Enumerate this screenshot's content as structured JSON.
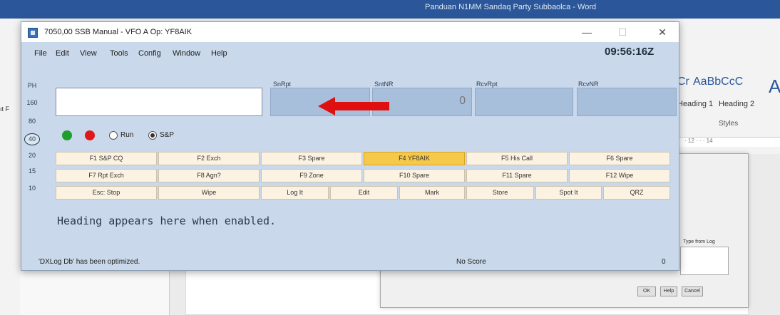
{
  "background": {
    "word_title": "Panduan N1MM Sandaq Party Subbaolca - Word",
    "style_normal": "AaBbCcC",
    "style_h1_label": "Heading 1",
    "style_h2_label": "Heading 2",
    "styles_group": "Styles",
    "ruler_text": "· 12 · · · 14",
    "heading_fragment": "Cr",
    "big_a": "A",
    "left_frag": "ıt F",
    "dialog_text": "Type from Log",
    "ok": "OK",
    "help": "Help",
    "cancel": "Cancel"
  },
  "window": {
    "title": "7050,00 SSB Manual - VFO A   Op: YF8AIK",
    "minimize": "—",
    "maximize": "☐",
    "close": "✕"
  },
  "menu": [
    "File",
    "Edit",
    "View",
    "Tools",
    "Config",
    "Window",
    "Help"
  ],
  "clock": "09:56:16Z",
  "bands": [
    "PH",
    "160",
    "80",
    "40",
    "20",
    "15",
    "10"
  ],
  "selected_band": "40",
  "fields": {
    "labels": [
      "SnRpt",
      "SntNR",
      "RcvRpt",
      "RcvNR"
    ],
    "sntnr_value": "0",
    "call_value": ""
  },
  "mode": {
    "run_label": "Run",
    "sp_label": "S&P",
    "selected": "S&P",
    "led_colors": [
      "#1f9e2c",
      "#e01818"
    ]
  },
  "fkeys": {
    "row1": [
      "F1 S&P CQ",
      "F2 Exch",
      "F3 Spare",
      "F4 YF8AIK",
      "F5 His Call",
      "F6 Spare"
    ],
    "row2": [
      "F7 Rpt Exch",
      "F8 Agn?",
      "F9 Zone",
      "F10 Spare",
      "F11 Spare",
      "F12 Wipe"
    ],
    "row3": [
      "Esc: Stop",
      "Wipe",
      "Log It",
      "Edit",
      "Mark",
      "Store",
      "Spot It",
      "QRZ"
    ],
    "active": "F4 YF8AIK",
    "active_color": "#f7c94b"
  },
  "heading_message": "Heading appears here when enabled.",
  "status": {
    "left": "'DXLog Db' has been optimized.",
    "middle": "No Score",
    "right": "0"
  },
  "annotation_arrow_color": "#e01010"
}
